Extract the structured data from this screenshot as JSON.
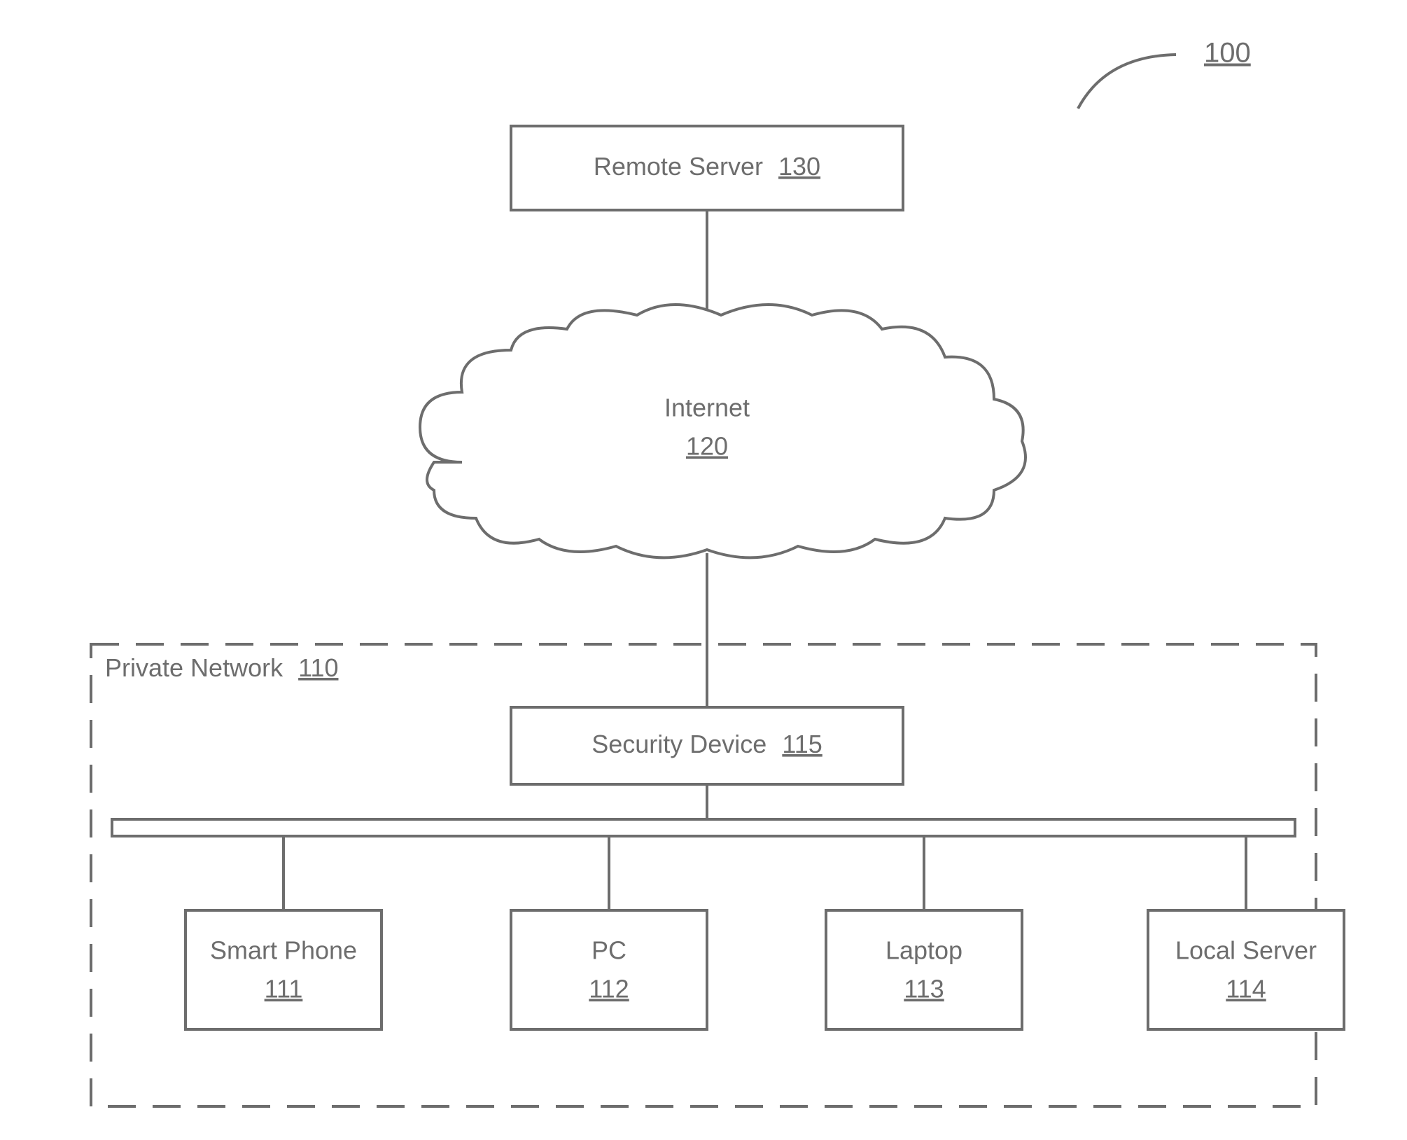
{
  "figure_ref": "100",
  "remote_server": {
    "label": "Remote Server",
    "ref": "130"
  },
  "internet": {
    "label": "Internet",
    "ref": "120"
  },
  "private_network": {
    "label": "Private Network",
    "ref": "110"
  },
  "security_device": {
    "label": "Security Device",
    "ref": "115"
  },
  "devices": [
    {
      "label": "Smart Phone",
      "ref": "111"
    },
    {
      "label": "PC",
      "ref": "112"
    },
    {
      "label": "Laptop",
      "ref": "113"
    },
    {
      "label": "Local Server",
      "ref": "114"
    }
  ]
}
